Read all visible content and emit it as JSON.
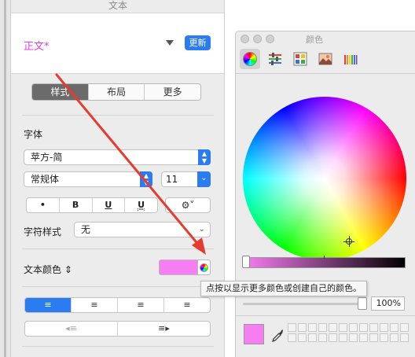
{
  "inspector": {
    "title": "文本",
    "paragraph_style": "正文*",
    "update_label": "更新",
    "tabs": [
      {
        "label": "样式",
        "active": true
      },
      {
        "label": "布局",
        "active": false
      },
      {
        "label": "更多",
        "active": false
      }
    ],
    "font_section_label": "字体",
    "font_family": "苹方-简",
    "font_typeface": "常规体",
    "font_size": "11",
    "format_buttons": [
      "•",
      "B",
      "U",
      "U̲"
    ],
    "gear_label": "⚙︎˅",
    "char_style_label": "字符样式",
    "char_style_value": "无",
    "text_color_label": "文本颜色 ⇕",
    "text_color": "#f77ef2",
    "align_buttons": [
      "≡",
      "≡",
      "≡",
      "≡"
    ],
    "indent_buttons": [
      "◂≡",
      "≡▸"
    ]
  },
  "colors_window": {
    "title": "颜色",
    "tools": [
      "color-wheel-icon",
      "sliders-icon",
      "palettes-icon",
      "image-palettes-icon",
      "pencils-icon"
    ],
    "opacity_value": "100%",
    "current_color": "#f77ef2"
  },
  "tooltip": {
    "text": "点按以显示更多颜色或创建自己的颜色。"
  },
  "annotation_color": "#e63b2e"
}
